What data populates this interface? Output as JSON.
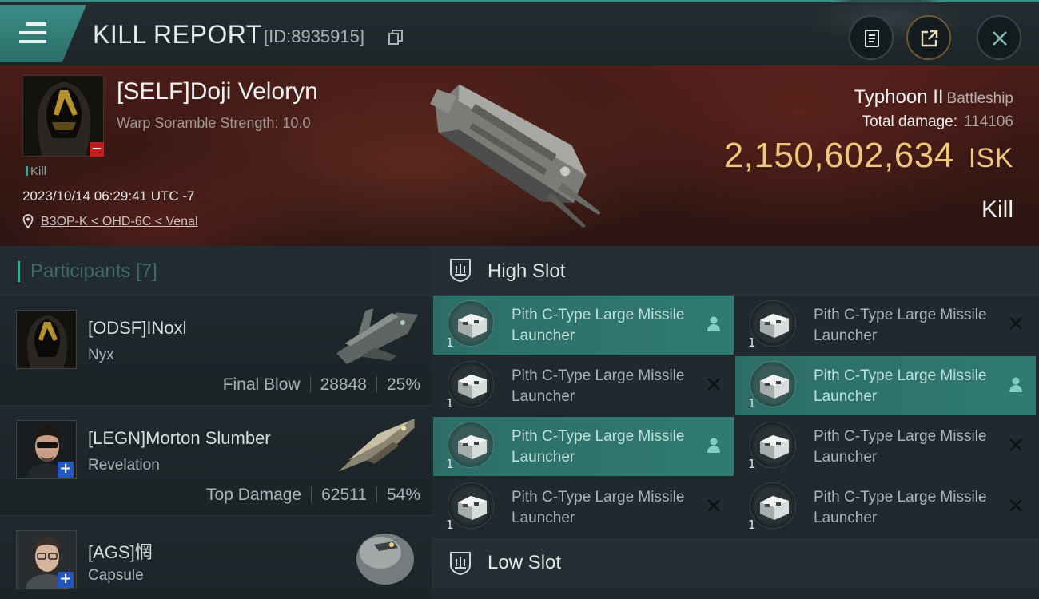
{
  "header": {
    "title": "KILL REPORT",
    "id_text": "[ID:8935915]"
  },
  "victim": {
    "name": "[SELF]Doji Veloryn",
    "subtitle": "Warp Soramble Strength: 10.0",
    "tag": "Kill",
    "timestamp": "2023/10/14 06:29:41 UTC -7",
    "location": "B3OP-K < OHD-6C < Venal",
    "ship": "Typhoon II",
    "ship_class": "Battleship",
    "total_damage_label": "Total damage:",
    "total_damage": "114106",
    "isk_value": "2,150,602,634",
    "isk_unit": "ISK",
    "result": "Kill"
  },
  "participants": {
    "header": "Participants [7]",
    "items": [
      {
        "name": "[ODSF]INoxl",
        "ship": "Nyx",
        "stat_label": "Final Blow",
        "damage": "28848",
        "percent": "25%"
      },
      {
        "name": "[LEGN]Morton Slumber",
        "ship": "Revelation",
        "stat_label": "Top Damage",
        "damage": "62511",
        "percent": "54%"
      },
      {
        "name": "[AGS]惘",
        "ship": "Capsule"
      }
    ]
  },
  "slots": {
    "high_label": "High Slot",
    "low_label": "Low Slot",
    "modules": [
      {
        "name": "Pith C-Type Large Missile Launcher",
        "qty": "1",
        "state": "dropped"
      },
      {
        "name": "Pith C-Type Large Missile Launcher",
        "qty": "1",
        "state": "destroyed"
      },
      {
        "name": "Pith C-Type Large Missile Launcher",
        "qty": "1",
        "state": "destroyed"
      },
      {
        "name": "Pith C-Type Large Missile Launcher",
        "qty": "1",
        "state": "dropped"
      },
      {
        "name": "Pith C-Type Large Missile Launcher",
        "qty": "1",
        "state": "dropped"
      },
      {
        "name": "Pith C-Type Large Missile Launcher",
        "qty": "1",
        "state": "destroyed"
      },
      {
        "name": "Pith C-Type Large Missile Launcher",
        "qty": "1",
        "state": "destroyed"
      },
      {
        "name": "Pith C-Type Large Missile Launcher",
        "qty": "1",
        "state": "destroyed"
      }
    ]
  },
  "icons": {
    "menu": "hamburger-menu-icon",
    "copy": "copy-icon",
    "clipboard": "clipboard-icon",
    "share": "share-icon",
    "close": "close-icon",
    "pin": "location-pin-icon",
    "person": "person-icon",
    "x": "x-mark-icon"
  },
  "colors": {
    "accent": "#3fa894",
    "isk": "#f0c77a",
    "active_module": "#2f7a72",
    "corp_badge": "#2256c4",
    "hostile_badge": "#c41f1f"
  }
}
